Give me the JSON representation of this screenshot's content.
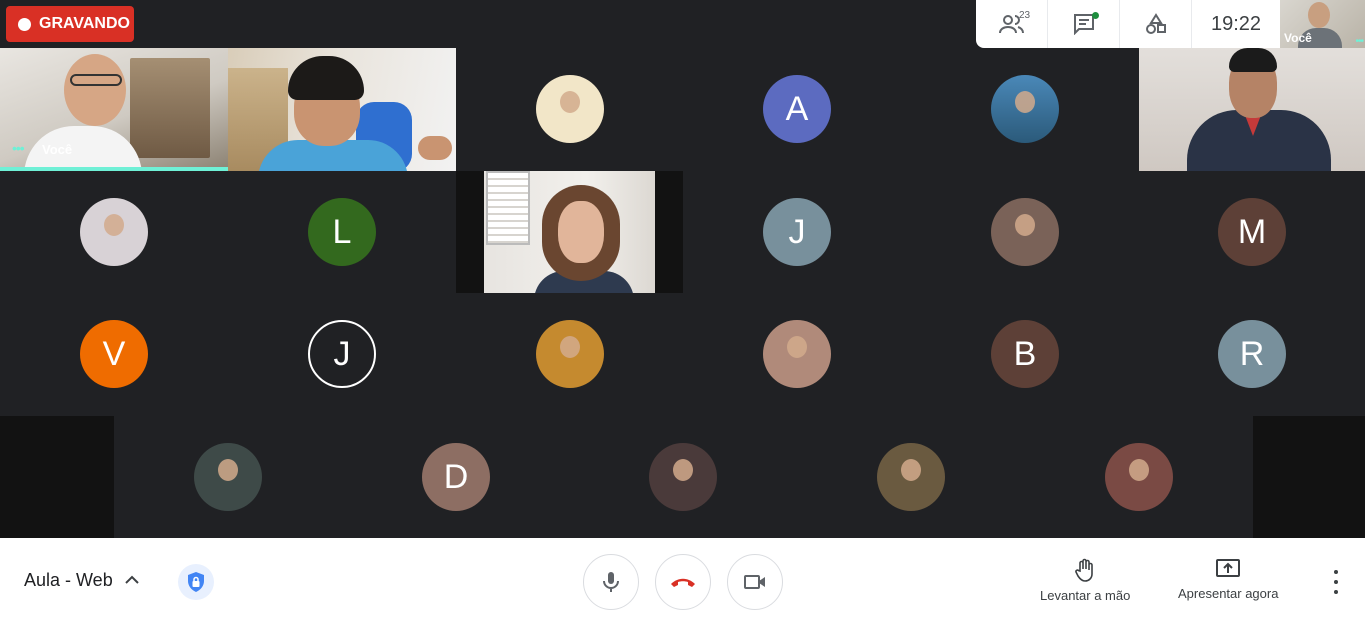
{
  "recording": {
    "label": "GRAVANDO",
    "color": "#d93025"
  },
  "top_panel": {
    "participants_icon": "people-icon",
    "participant_count": "23",
    "chat_icon": "chat-icon",
    "activities_icon": "shapes-icon",
    "time": "19:22"
  },
  "self_view": {
    "label": "Você"
  },
  "tiles": {
    "you_label": "Você",
    "avatars": [
      {
        "kind": "photo",
        "color": "#f2e6c8"
      },
      {
        "kind": "letter",
        "letter": "A",
        "color": "#5c6bc0"
      },
      {
        "kind": "photo",
        "color": "#4a88b8"
      },
      {
        "kind": "photo",
        "color": "#d8d2d6"
      },
      {
        "kind": "letter",
        "letter": "L",
        "color": "#33691e"
      },
      {
        "kind": "letter",
        "letter": "J",
        "color": "#78909c"
      },
      {
        "kind": "photo",
        "color": "#7a6258"
      },
      {
        "kind": "letter",
        "letter": "M",
        "color": "#5d4037"
      },
      {
        "kind": "letter",
        "letter": "V",
        "color": "#ef6c00"
      },
      {
        "kind": "letter",
        "letter": "J",
        "color": "#202124"
      },
      {
        "kind": "photo",
        "color": "#c58a2f"
      },
      {
        "kind": "photo",
        "color": "#b08a7a"
      },
      {
        "kind": "letter",
        "letter": "B",
        "color": "#5d4037"
      },
      {
        "kind": "letter",
        "letter": "R",
        "color": "#78909c"
      },
      {
        "kind": "photo",
        "color": "#3e4a48"
      },
      {
        "kind": "letter",
        "letter": "D",
        "color": "#8d6e63"
      },
      {
        "kind": "photo",
        "color": "#4a3a3a"
      },
      {
        "kind": "photo",
        "color": "#6a5a40"
      },
      {
        "kind": "photo",
        "color": "#7a4a44"
      }
    ]
  },
  "toolbar": {
    "meeting_title": "Aula - Web",
    "raise_hand_label": "Levantar a mão",
    "present_label": "Apresentar agora"
  },
  "colors": {
    "background": "#202124",
    "accent": "#6ff0d6",
    "end_call": "#d93025"
  }
}
